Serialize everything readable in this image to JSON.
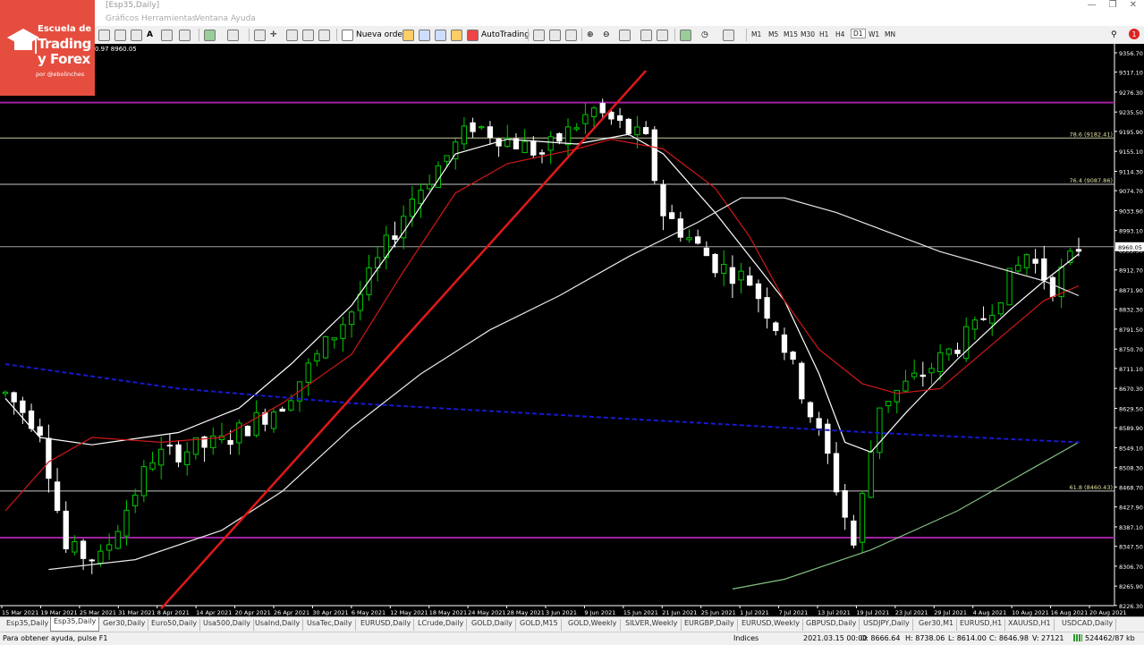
{
  "window": {
    "title": "[Esp35,Daily]"
  },
  "logo": {
    "line1": "Escuela de",
    "line2": "Trading",
    "line3": "y Forex",
    "line4": "por @ebolinches"
  },
  "menu": [
    "Gráficos",
    "Herramientas",
    "Ventana",
    "Ayuda"
  ],
  "toolbar": {
    "new_order_label": "Nueva orden",
    "autotrading_label": "AutoTrading",
    "timeframes": [
      "M1",
      "M5",
      "M15",
      "M30",
      "H1",
      "H4",
      "D1",
      "W1",
      "MN"
    ],
    "active_timeframe": "D1",
    "icons": [
      "new-chart-icon",
      "profiles-icon",
      "market-watch-icon",
      "data-window-icon",
      "navigator-icon",
      "terminal-icon",
      "strategy-tester-icon",
      "text-tool-icon",
      "objects-icon",
      "zoom-in-icon",
      "zoom-out-icon",
      "crosshair-icon",
      "search-icon",
      "notification-icon"
    ]
  },
  "ohlc_info": "0.97 8960.05",
  "chart_data": {
    "type": "candlestick",
    "symbol": "Esp35",
    "timeframe": "Daily",
    "background": "#000000",
    "bull_color": "#00c800",
    "bull_body": "#000000",
    "bear_color": "#ffffff",
    "bear_body": "#ffffff",
    "ylim": [
      8226.0,
      9375.0
    ],
    "y_ticks": [
      "9356.70",
      "9317.10",
      "9276.30",
      "9235.50",
      "9195.90",
      "9155.10",
      "9114.30",
      "9074.70",
      "9033.90",
      "8993.10",
      "8953.50",
      "8912.70",
      "8871.90",
      "8832.30",
      "8791.50",
      "8750.70",
      "8711.10",
      "8670.30",
      "8629.50",
      "8589.90",
      "8549.10",
      "8508.30",
      "8468.70",
      "8427.90",
      "8387.10",
      "8347.50",
      "8306.70",
      "8265.90",
      "8226.30"
    ],
    "current_price": "8960.05",
    "current_price_value": 8960.05,
    "x_ticks": [
      "15 Mar 2021",
      "19 Mar 2021",
      "25 Mar 2021",
      "31 Mar 2021",
      "8 Apr 2021",
      "14 Apr 2021",
      "20 Apr 2021",
      "26 Apr 2021",
      "30 Apr 2021",
      "6 May 2021",
      "12 May 2021",
      "18 May 2021",
      "24 May 2021",
      "28 May 2021",
      "3 Jun 2021",
      "9 Jun 2021",
      "15 Jun 2021",
      "21 Jun 2021",
      "25 Jun 2021",
      "1 Jul 2021",
      "7 Jul 2021",
      "13 Jul 2021",
      "19 Jul 2021",
      "23 Jul 2021",
      "29 Jul 2021",
      "4 Aug 2021",
      "10 Aug 2021",
      "16 Aug 2021",
      "20 Aug 2021"
    ],
    "candle_count": 125,
    "key_points": [
      {
        "index": 0,
        "price": 8660
      },
      {
        "index": 4,
        "price": 8590
      },
      {
        "index": 7,
        "price": 8340
      },
      {
        "index": 11,
        "price": 8320
      },
      {
        "index": 17,
        "price": 8530
      },
      {
        "index": 25,
        "price": 8560
      },
      {
        "index": 32,
        "price": 8640
      },
      {
        "index": 40,
        "price": 8830
      },
      {
        "index": 47,
        "price": 9060
      },
      {
        "index": 54,
        "price": 9210
      },
      {
        "index": 62,
        "price": 9150
      },
      {
        "index": 68,
        "price": 9240
      },
      {
        "index": 74,
        "price": 9175
      },
      {
        "index": 76,
        "price": 9030
      },
      {
        "index": 82,
        "price": 8925
      },
      {
        "index": 86,
        "price": 8890
      },
      {
        "index": 89,
        "price": 8800
      },
      {
        "index": 95,
        "price": 8530
      },
      {
        "index": 98,
        "price": 8350
      },
      {
        "index": 101,
        "price": 8640
      },
      {
        "index": 106,
        "price": 8700
      },
      {
        "index": 112,
        "price": 8790
      },
      {
        "index": 118,
        "price": 8945
      },
      {
        "index": 121,
        "price": 8880
      },
      {
        "index": 124,
        "price": 8960
      }
    ],
    "series": [
      {
        "key": "ma_fast",
        "color": "#ffffff",
        "points": [
          [
            0,
            8650
          ],
          [
            4,
            8570
          ],
          [
            10,
            8555
          ],
          [
            20,
            8580
          ],
          [
            27,
            8630
          ],
          [
            33,
            8720
          ],
          [
            40,
            8840
          ],
          [
            46,
            8990
          ],
          [
            52,
            9150
          ],
          [
            58,
            9180
          ],
          [
            66,
            9170
          ],
          [
            72,
            9190
          ],
          [
            76,
            9150
          ],
          [
            82,
            9030
          ],
          [
            86,
            8940
          ],
          [
            90,
            8850
          ],
          [
            94,
            8700
          ],
          [
            97,
            8560
          ],
          [
            100,
            8540
          ],
          [
            104,
            8620
          ],
          [
            110,
            8730
          ],
          [
            116,
            8830
          ],
          [
            120,
            8890
          ],
          [
            124,
            8945
          ]
        ]
      },
      {
        "key": "ma_red",
        "color": "#d01818",
        "points": [
          [
            0,
            8420
          ],
          [
            5,
            8520
          ],
          [
            10,
            8570
          ],
          [
            18,
            8560
          ],
          [
            25,
            8570
          ],
          [
            32,
            8640
          ],
          [
            40,
            8740
          ],
          [
            46,
            8910
          ],
          [
            52,
            9070
          ],
          [
            58,
            9130
          ],
          [
            66,
            9160
          ],
          [
            70,
            9180
          ],
          [
            76,
            9160
          ],
          [
            82,
            9080
          ],
          [
            86,
            8980
          ],
          [
            90,
            8850
          ],
          [
            94,
            8750
          ],
          [
            99,
            8680
          ],
          [
            103,
            8660
          ],
          [
            108,
            8670
          ],
          [
            114,
            8760
          ],
          [
            120,
            8850
          ],
          [
            124,
            8880
          ]
        ]
      },
      {
        "key": "ma_slow",
        "color": "#e8e8e8",
        "points": [
          [
            5,
            8300
          ],
          [
            15,
            8320
          ],
          [
            25,
            8380
          ],
          [
            32,
            8460
          ],
          [
            40,
            8590
          ],
          [
            48,
            8700
          ],
          [
            56,
            8790
          ],
          [
            64,
            8860
          ],
          [
            72,
            8940
          ],
          [
            80,
            9010
          ],
          [
            85,
            9060
          ],
          [
            90,
            9060
          ],
          [
            96,
            9030
          ],
          [
            102,
            8990
          ],
          [
            108,
            8950
          ],
          [
            114,
            8920
          ],
          [
            120,
            8890
          ],
          [
            124,
            8860
          ]
        ]
      },
      {
        "key": "ma_green",
        "color": "#80c080",
        "points": [
          [
            84,
            8260
          ],
          [
            90,
            8280
          ],
          [
            100,
            8340
          ],
          [
            110,
            8420
          ],
          [
            118,
            8500
          ],
          [
            124,
            8560
          ]
        ]
      },
      {
        "key": "ma_blue_dashed",
        "color": "#1818d0",
        "points": [
          [
            0,
            8720
          ],
          [
            20,
            8670
          ],
          [
            40,
            8640
          ],
          [
            60,
            8620
          ],
          [
            80,
            8600
          ],
          [
            100,
            8580
          ],
          [
            124,
            8560
          ]
        ]
      }
    ],
    "horizontal_lines": [
      {
        "price": 9255,
        "color": "#a020a0"
      },
      {
        "price": 9182.41,
        "color": "#c8c8a0",
        "label": "78.6 (9182.41)"
      },
      {
        "price": 9087.86,
        "color": "#c8c8c8",
        "label": "76.4 (9087.86)"
      },
      {
        "price": 8960.05,
        "color": "#a0a0a0"
      },
      {
        "price": 8460.43,
        "color": "#c8c8c8",
        "label": "61.8 (8460.43)"
      },
      {
        "price": 8365,
        "color": "#a020a0"
      }
    ],
    "trendline": {
      "color": "#e01818",
      "from": {
        "index": 18,
        "price": 8220
      },
      "to": {
        "index": 74,
        "price": 9320
      }
    }
  },
  "tabs": [
    "Esp35,Daily",
    "Esp35,Daily",
    "Ger30,Daily",
    "Euro50,Daily",
    "Usa500,Daily",
    "UsaInd,Daily",
    "UsaTec,Daily",
    "EURUSD,Daily",
    "LCrude,Daily",
    "GOLD,Daily",
    "GOLD,M15",
    "GOLD,Weekly",
    "SILVER,Weekly",
    "EURGBP,Daily",
    "EURUSD,Weekly",
    "GBPUSD,Daily",
    "USDJPY,Daily",
    "Ger30,M1",
    "EURUSD,H1",
    "XAUUSD,H1",
    "USDCAD,Daily"
  ],
  "active_tab": 1,
  "status": {
    "help": "Para obtener ayuda, pulse F1",
    "profile": "Indices",
    "datetime": "2021.03.15 00:00",
    "open": "O: 8666.64",
    "high": "H: 8738.06",
    "low": "L: 8614.00",
    "close": "C: 8646.98",
    "volume": "V: 27121",
    "traffic": "524462/87 kb"
  }
}
